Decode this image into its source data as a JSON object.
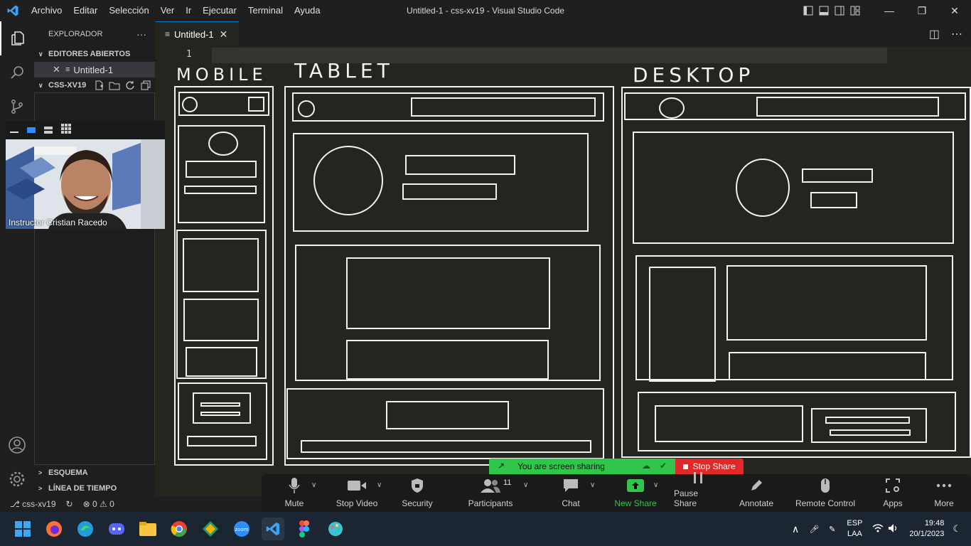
{
  "titlebar": {
    "menu": [
      "Archivo",
      "Editar",
      "Selección",
      "Ver",
      "Ir",
      "Ejecutar",
      "Terminal",
      "Ayuda"
    ],
    "window_title": "Untitled-1 - css-xv19 - Visual Studio Code"
  },
  "sidebar": {
    "header": "EXPLORADOR",
    "more": "···",
    "open_editors": "EDITORES ABIERTOS",
    "open_file": "Untitled-1",
    "project": "CSS-XV19",
    "outline": "ESQUEMA",
    "timeline": "LÍNEA DE TIEMPO"
  },
  "editor": {
    "tab_label": "Untitled-1",
    "line_number": "1",
    "drawing_labels": {
      "mobile": "MOBILE",
      "tablet": "TABLET",
      "desktop": "DESKTOP"
    }
  },
  "webcam": {
    "name": "Instructor Cristian Racedo"
  },
  "statusbar": {
    "branch": "css-xv19",
    "errors": "0",
    "warnings": "0"
  },
  "zoom": {
    "banner": "You are screen sharing",
    "stop_share": "Stop Share",
    "participants_count": "11",
    "buttons": {
      "mute": "Mute",
      "stop_video": "Stop Video",
      "security": "Security",
      "participants": "Participants",
      "chat": "Chat",
      "new_share": "New Share",
      "pause_share": "Pause Share",
      "annotate": "Annotate",
      "remote_control": "Remote Control",
      "apps": "Apps",
      "more": "More"
    }
  },
  "taskbar": {
    "lang": "ESP",
    "layout": "LAA",
    "time": "19:48",
    "date": "20/1/2023"
  },
  "colors": {
    "accent_blue": "#0078d4",
    "share_green": "#2fc64b",
    "stop_red": "#e02828",
    "canvas_bg": "#25251f"
  }
}
